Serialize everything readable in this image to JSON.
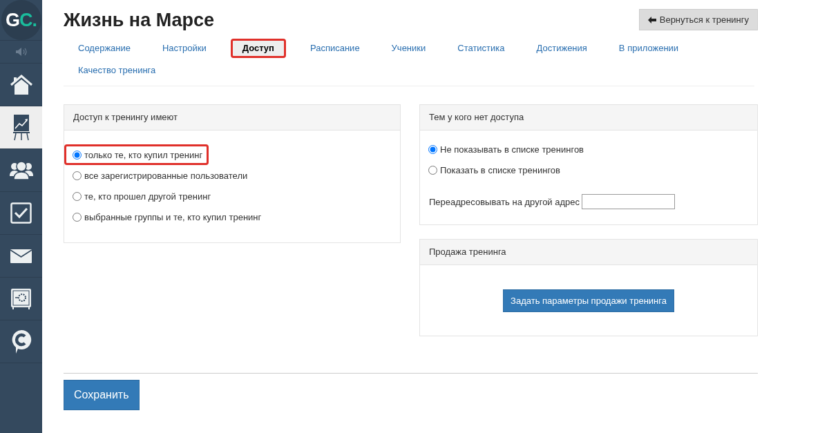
{
  "sidebar": {
    "logo": {
      "letter_1": "G",
      "letter_2": "C."
    },
    "items": [
      {
        "kind": "speaker",
        "selected": false
      },
      {
        "kind": "home",
        "selected": false
      },
      {
        "kind": "chart",
        "selected": true
      },
      {
        "kind": "people",
        "selected": false
      },
      {
        "kind": "checkbox",
        "selected": false
      },
      {
        "kind": "mail",
        "selected": false
      },
      {
        "kind": "safe",
        "selected": false
      },
      {
        "kind": "chat",
        "selected": false
      }
    ]
  },
  "header": {
    "title": "Жизнь на Марсе",
    "back_button": "Вернуться к тренингу"
  },
  "tabs": [
    {
      "label": "Содержание",
      "selected": false
    },
    {
      "label": "Настройки",
      "selected": false
    },
    {
      "label": "Доступ",
      "selected": true
    },
    {
      "label": "Расписание",
      "selected": false
    },
    {
      "label": "Ученики",
      "selected": false
    },
    {
      "label": "Статистика",
      "selected": false
    },
    {
      "label": "Достижения",
      "selected": false
    },
    {
      "label": "В приложении",
      "selected": false
    },
    {
      "label": "Качество тренинга",
      "selected": false
    }
  ],
  "access_panel": {
    "title": "Доступ к тренингу имеют",
    "options": [
      {
        "label": "только те, кто купил тренинг",
        "selected": true,
        "highlighted": true
      },
      {
        "label": "все зарегистрированные пользователи",
        "selected": false,
        "highlighted": false
      },
      {
        "label": "те, кто прошел другой тренинг",
        "selected": false,
        "highlighted": false
      },
      {
        "label": "выбранные группы и те, кто купил тренинг",
        "selected": false,
        "highlighted": false
      }
    ]
  },
  "no_access_panel": {
    "title": "Тем у кого нет доступа",
    "options": [
      {
        "label": "Не показывать в списке тренингов",
        "selected": true
      },
      {
        "label": "Показать в списке тренингов",
        "selected": false
      }
    ],
    "redirect_label": "Переадресовывать на другой адрес"
  },
  "sale_panel": {
    "title": "Продажа тренинга",
    "button": "Задать параметры продажи тренинга"
  },
  "save_button": "Сохранить"
}
